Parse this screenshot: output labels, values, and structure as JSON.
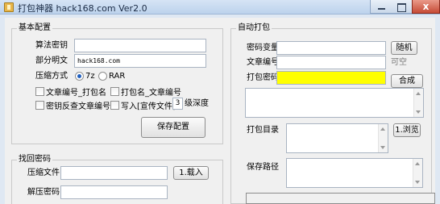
{
  "window": {
    "title": "打包神器 hack168.com Ver2.0",
    "close_glyph": "x"
  },
  "basic": {
    "legend": "基本配置",
    "algo_label": "算法密钥",
    "algo_value": "",
    "plain_label": "部分明文",
    "plain_value": "hack168.com",
    "compress_label": "压缩方式",
    "compress_options": [
      "7z",
      "RAR"
    ],
    "compress_selected": "7z",
    "cb_article_pack": "文章编号_打包名",
    "cb_pack_article": "打包名_文章编号",
    "cb_key_reverse": "密钥反查文章编号",
    "cb_write": "写入[宣传文件]",
    "depth_value": "3",
    "depth_label": "级深度",
    "save_btn": "保存配置"
  },
  "auto": {
    "legend": "自动打包",
    "key_var_label": "密码变量",
    "key_var_value": "",
    "random_btn": "随机",
    "article_label": "文章编号",
    "article_value": "",
    "optional_hint": "可空",
    "pack_pwd_label": "打包密码",
    "pack_pwd_value": "",
    "compose_btn": "合成",
    "pack_dir_label": "打包目录",
    "browse_btn": "1.浏览",
    "save_path_label": "保存路径"
  },
  "retrieve": {
    "legend": "找回密码",
    "archive_label": "压缩文件",
    "archive_value": "",
    "load_btn": "1.载入",
    "unzip_label": "解压密码",
    "unzip_value": ""
  }
}
